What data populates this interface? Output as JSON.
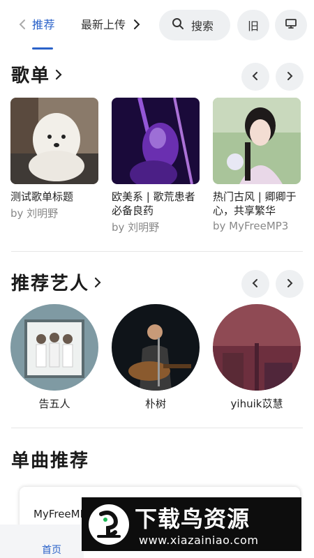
{
  "header": {
    "tab_recommend": "推荐",
    "tab_latest": "最新上传",
    "search_label": "搜索",
    "old_label": "旧"
  },
  "playlists_section": {
    "title": "歌单",
    "items": [
      {
        "title": "测试歌单标题",
        "by": "by 刘明野"
      },
      {
        "title": "欧美系 | 歌荒患者必备良药",
        "by": "by 刘明野"
      },
      {
        "title": "热门古风 | 卿卿于心，共享繁华",
        "by": "by MyFreeMP3"
      }
    ]
  },
  "artists_section": {
    "title": "推荐艺人",
    "items": [
      {
        "name": "告五人"
      },
      {
        "name": "朴树"
      },
      {
        "name": "yihuik苡慧"
      }
    ]
  },
  "songs_section": {
    "title": "单曲推荐",
    "first_source": "MyFreeMP3"
  },
  "bottom_nav": {
    "home_label": "首页"
  },
  "watermark": {
    "brand": "下载鸟资源",
    "url": "www.xiazainiao.com"
  },
  "colors": {
    "accent": "#2a62c9",
    "button_bg": "#eef0f2"
  }
}
